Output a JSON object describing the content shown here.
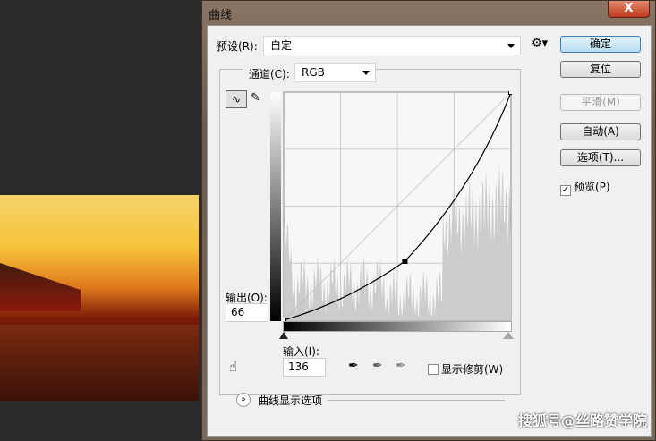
{
  "dialog": {
    "title": "曲线",
    "close_label": "X"
  },
  "preset": {
    "label": "预设(R):",
    "value": "自定"
  },
  "channel": {
    "label": "通道(C):",
    "value": "RGB"
  },
  "buttons": {
    "ok": "确定",
    "reset": "复位",
    "smooth": "平滑(M)",
    "auto": "自动(A)",
    "options": "选项(T)..."
  },
  "preview": {
    "label": "预览(P)",
    "checked": true
  },
  "output": {
    "label": "输出(O):",
    "value": "66"
  },
  "input": {
    "label": "输入(I):",
    "value": "136"
  },
  "show_clipping": {
    "label": "显示修剪(W)",
    "checked": false
  },
  "curve_options": {
    "label": "曲线显示选项"
  },
  "curve": {
    "points": [
      [
        0,
        0
      ],
      [
        136,
        66
      ],
      [
        255,
        255
      ]
    ],
    "range": [
      0,
      255
    ]
  },
  "watermark": "搜狐号@丝路赞学院",
  "colors": {
    "accent": "#3c7fb1",
    "titlebar": "#7a6656"
  }
}
